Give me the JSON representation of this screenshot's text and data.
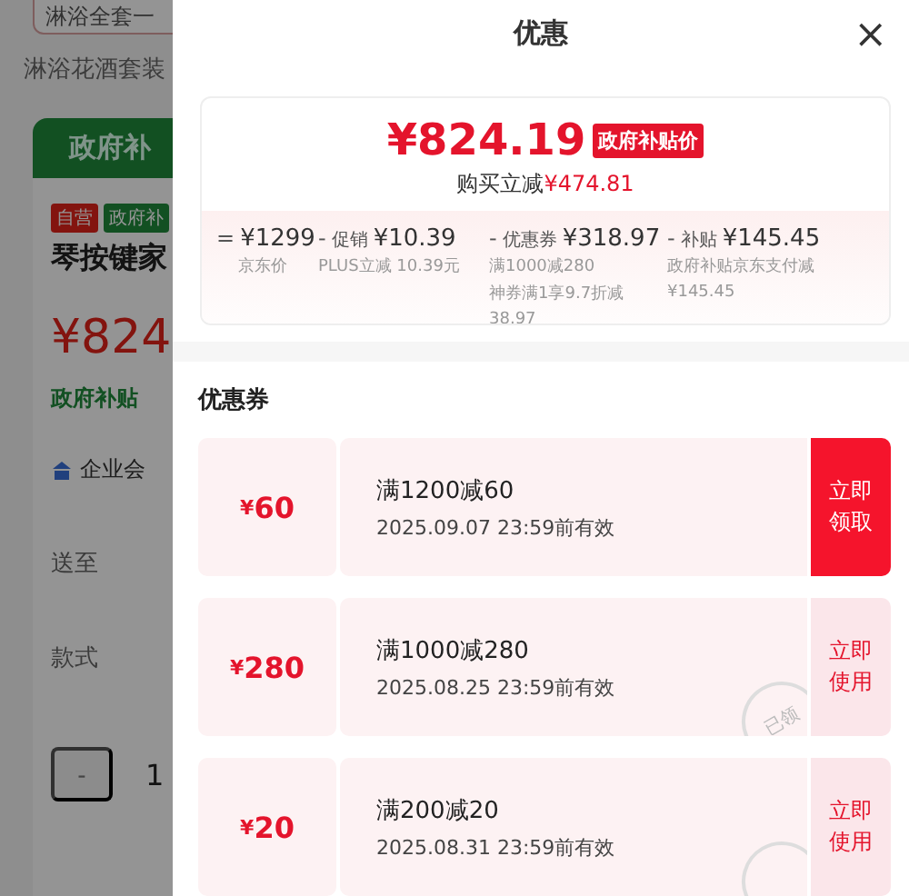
{
  "background_page": {
    "search_value": "淋浴全套一",
    "keyword": "淋浴花酒套装",
    "tab": "政府补",
    "tags": [
      "自营",
      "政府补"
    ],
    "title": "琴按键家",
    "price": "¥824",
    "subsidy": "政府补贴",
    "enterprise": "企业会",
    "rows": [
      "送至",
      "款式"
    ],
    "qty_minus": "-",
    "qty": "1"
  },
  "sheet": {
    "title": "优惠",
    "close": "×",
    "price": {
      "amount": "¥824.19",
      "badge": "政府补贴价",
      "saving_label": "购买立减",
      "saving_amount": "¥474.81"
    },
    "breakdown": [
      {
        "op": "=",
        "amount": "¥1299",
        "notes": [
          "京东价"
        ]
      },
      {
        "op": "-",
        "label": "促销",
        "amount": "¥10.39",
        "notes": [
          "PLUS立减 10.39元"
        ]
      },
      {
        "op": "-",
        "label": "优惠券",
        "amount": "¥318.97",
        "notes": [
          "满1000减280",
          "神券满1享9.7折减38.97"
        ]
      },
      {
        "op": "-",
        "label": "补贴",
        "amount": "¥145.45",
        "notes": [
          "政府补贴京东支付减¥145.45"
        ]
      }
    ],
    "coupons_heading": "优惠券",
    "coupons": [
      {
        "currency": "¥",
        "value": "60",
        "condition": "满1200减60",
        "validity": "2025.09.07 23:59前有效",
        "action": "立即领取",
        "claimed": false
      },
      {
        "currency": "¥",
        "value": "280",
        "condition": "满1000减280",
        "validity": "2025.08.25 23:59前有效",
        "action": "立即使用",
        "claimed": true,
        "stamp": "已领"
      },
      {
        "currency": "¥",
        "value": "20",
        "condition": "满200减20",
        "validity": "2025.08.31 23:59前有效",
        "action": "立即使用",
        "claimed": true
      }
    ]
  }
}
